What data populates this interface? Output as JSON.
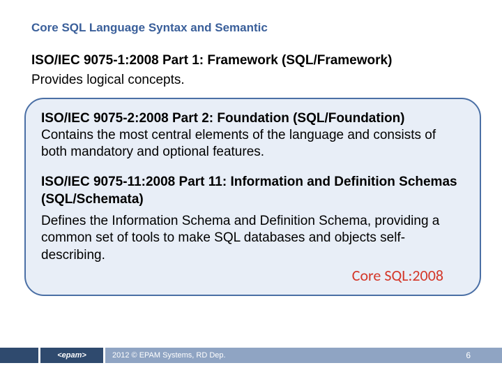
{
  "slide": {
    "title": "Core SQL Language Syntax and Semantic",
    "part1": {
      "heading": "ISO/IEC 9075-1:2008 Part 1: Framework (SQL/Framework)",
      "desc": "Provides logical concepts."
    },
    "callout": {
      "part2": {
        "heading": "ISO/IEC 9075-2:2008 Part 2: Foundation (SQL/Foundation)",
        "desc": "Contains the most central elements of the language and consists of both mandatory and optional features."
      },
      "part11": {
        "heading": "ISO/IEC 9075-11:2008 Part 11: Information and Definition Schemas (SQL/Schemata)",
        "desc": "Defines the Information Schema and Definition Schema, providing a common set of tools to make SQL databases and objects self-describing."
      },
      "core_label": "Core SQL:2008"
    }
  },
  "footer": {
    "logo": "<epam>",
    "copyright": "2012 © EPAM Systems, RD Dep.",
    "page": "6"
  }
}
